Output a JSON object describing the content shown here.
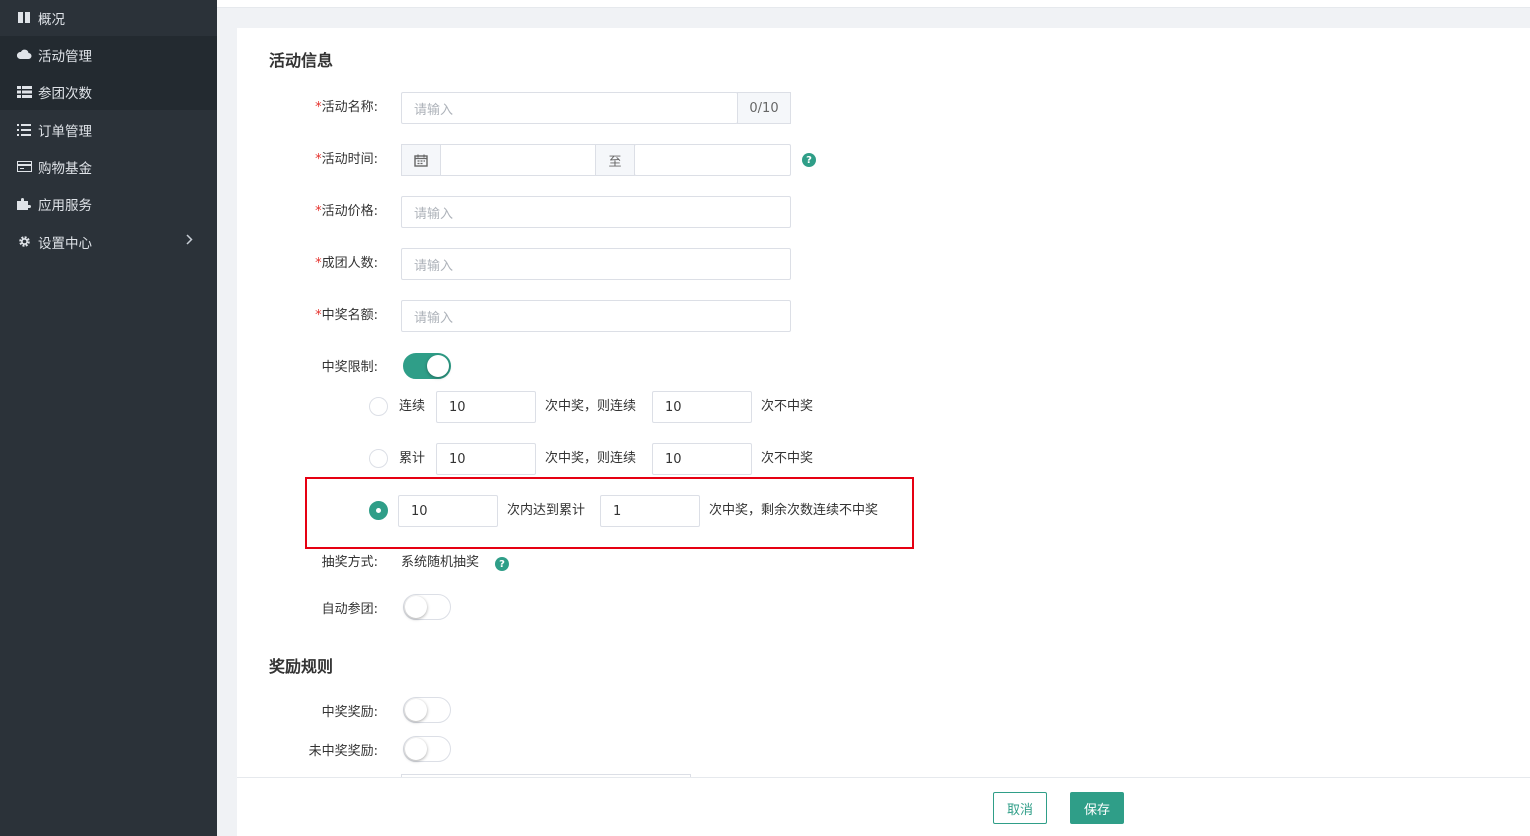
{
  "sidebar": {
    "items": [
      {
        "label": "概况",
        "icon": "book-icon"
      },
      {
        "label": "活动管理",
        "icon": "cloud-icon"
      },
      {
        "label": "参团次数",
        "icon": "table-icon"
      },
      {
        "label": "订单管理",
        "icon": "list-icon"
      },
      {
        "label": "购物基金",
        "icon": "card-icon"
      },
      {
        "label": "应用服务",
        "icon": "puzzle-icon"
      },
      {
        "label": "设置中心",
        "icon": "gear-icon"
      }
    ]
  },
  "form": {
    "section1_title": "活动信息",
    "required_mark": "*",
    "name": {
      "label": "活动名称:",
      "placeholder": "请输入",
      "counter": "0/10"
    },
    "time": {
      "label": "活动时间:",
      "separator": "至",
      "start_value": "",
      "end_value": ""
    },
    "price": {
      "label": "活动价格:",
      "placeholder": "请输入"
    },
    "group_size": {
      "label": "成团人数:",
      "placeholder": "请输入"
    },
    "winners": {
      "label": "中奖名额:",
      "placeholder": "请输入"
    },
    "limit": {
      "label": "中奖限制:",
      "enabled": true,
      "options": [
        {
          "prefix": "连续",
          "value1": "10",
          "middle": "次中奖，则连续",
          "value2": "10",
          "suffix": "次不中奖",
          "checked": false
        },
        {
          "prefix": "累计",
          "value1": "10",
          "middle": "次中奖，则连续",
          "value2": "10",
          "suffix": "次不中奖",
          "checked": false
        },
        {
          "prefix": "",
          "value1": "10",
          "middle": "次内达到累计",
          "value2": "1",
          "suffix": "次中奖，剩余次数连续不中奖",
          "checked": true
        }
      ]
    },
    "draw_method": {
      "label": "抽奖方式:",
      "value": "系统随机抽奖"
    },
    "auto_join": {
      "label": "自动参团:",
      "enabled": false
    },
    "section2_title": "奖励规则",
    "win_reward": {
      "label": "中奖奖励:",
      "enabled": false
    },
    "lose_reward": {
      "label": "未中奖奖励:",
      "enabled": false
    }
  },
  "footer": {
    "cancel_label": "取消",
    "save_label": "保存"
  },
  "colors": {
    "accent": "#2f9e88",
    "sidebar_bg": "#2b3239",
    "highlight": "#e60012",
    "required": "#e5322d"
  }
}
